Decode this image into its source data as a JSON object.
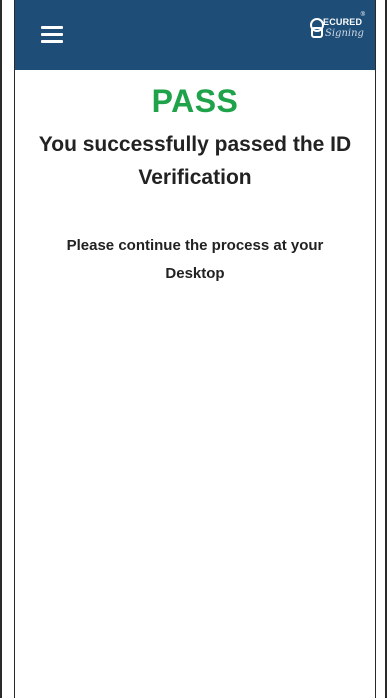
{
  "header": {
    "menu_icon": "hamburger-menu-icon",
    "logo": {
      "top_text": "ECURED",
      "bottom_text": "Signing",
      "registered_mark": "®",
      "brand_color": "#1e4d78"
    }
  },
  "main": {
    "status": "PASS",
    "status_color": "#1fa34a",
    "message": "You successfully passed the ID Verification",
    "instruction": "Please continue the process at your Desktop"
  }
}
